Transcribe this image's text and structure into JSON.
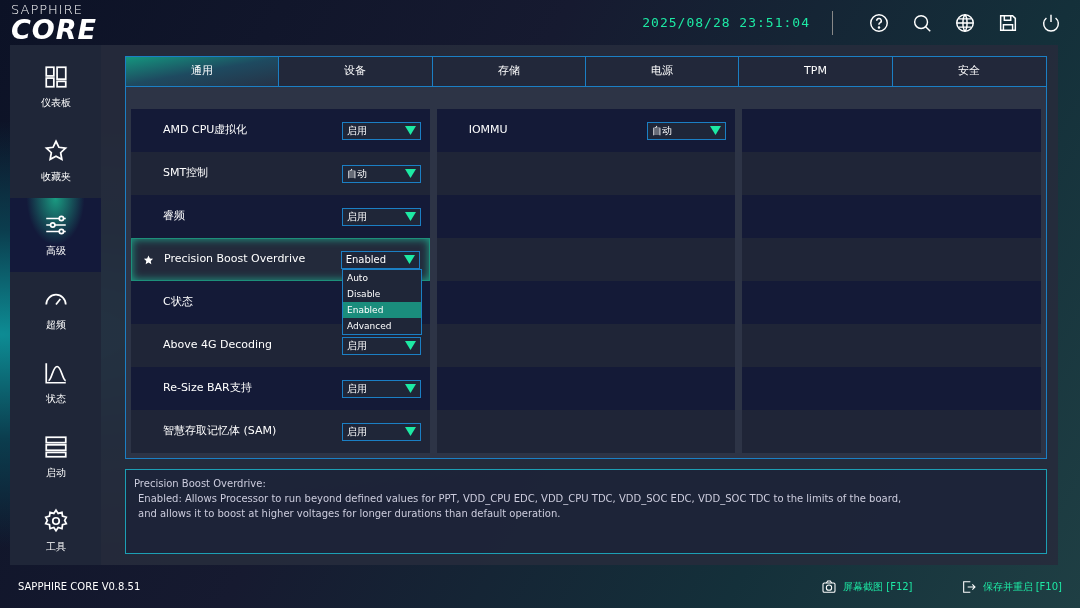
{
  "logo": {
    "brand": "SAPPHIRE",
    "product": "CORE"
  },
  "clock": "2025/08/28 23:51:04",
  "sidebar": {
    "items": [
      {
        "label": "仪表板",
        "kind": "dashboard",
        "selected": false
      },
      {
        "label": "收藏夹",
        "kind": "favorites",
        "selected": false
      },
      {
        "label": "高级",
        "kind": "advanced",
        "selected": true
      },
      {
        "label": "超频",
        "kind": "overclock",
        "selected": false
      },
      {
        "label": "状态",
        "kind": "status",
        "selected": false
      },
      {
        "label": "启动",
        "kind": "boot",
        "selected": false
      },
      {
        "label": "工具",
        "kind": "tools",
        "selected": false
      }
    ]
  },
  "tabs": [
    {
      "label": "通用",
      "selected": true
    },
    {
      "label": "设备",
      "selected": false
    },
    {
      "label": "存储",
      "selected": false
    },
    {
      "label": "电源",
      "selected": false
    },
    {
      "label": "TPM",
      "selected": false
    },
    {
      "label": "安全",
      "selected": false
    }
  ],
  "settings_column_1": [
    {
      "label": "AMD CPU虚拟化",
      "value": "启用",
      "starred": false,
      "focused": false
    },
    {
      "label": "SMT控制",
      "value": "自动",
      "starred": false,
      "focused": false
    },
    {
      "label": "睿频",
      "value": "启用",
      "starred": false,
      "focused": false
    },
    {
      "label": "Precision Boost Overdrive",
      "value": "Enabled",
      "starred": true,
      "focused": true,
      "dropdown": [
        {
          "label": "Auto",
          "selected": false
        },
        {
          "label": "Disable",
          "selected": false
        },
        {
          "label": "Enabled",
          "selected": true
        },
        {
          "label": "Advanced",
          "selected": false
        }
      ]
    },
    {
      "label": "C状态",
      "starred": false,
      "focused": false
    },
    {
      "label": "Above 4G Decoding",
      "value": "启用",
      "starred": false,
      "focused": false
    },
    {
      "label": "Re-Size BAR支持",
      "value": "启用",
      "starred": false,
      "focused": false
    },
    {
      "label": "智慧存取记忆体 (SAM)",
      "value": "启用",
      "starred": false,
      "focused": false
    }
  ],
  "settings_column_2": [
    {
      "label": "IOMMU",
      "value": "自动",
      "starred": false,
      "focused": false
    }
  ],
  "help": {
    "title": "Precision Boost Overdrive:",
    "lines": [
      "Enabled: Allows Processor to run beyond defined values for PPT, VDD_CPU EDC, VDD_CPU TDC, VDD_SOC EDC, VDD_SOC TDC to the limits of the board,",
      "and allows it to boost at higher voltages for longer durations than default operation."
    ]
  },
  "footer": {
    "version": "SAPPHIRE CORE V0.8.51",
    "actions": [
      {
        "label": "屏幕截图 [F12]",
        "kind": "screenshot"
      },
      {
        "label": "保存并重启 [F10]",
        "kind": "exit"
      }
    ]
  }
}
